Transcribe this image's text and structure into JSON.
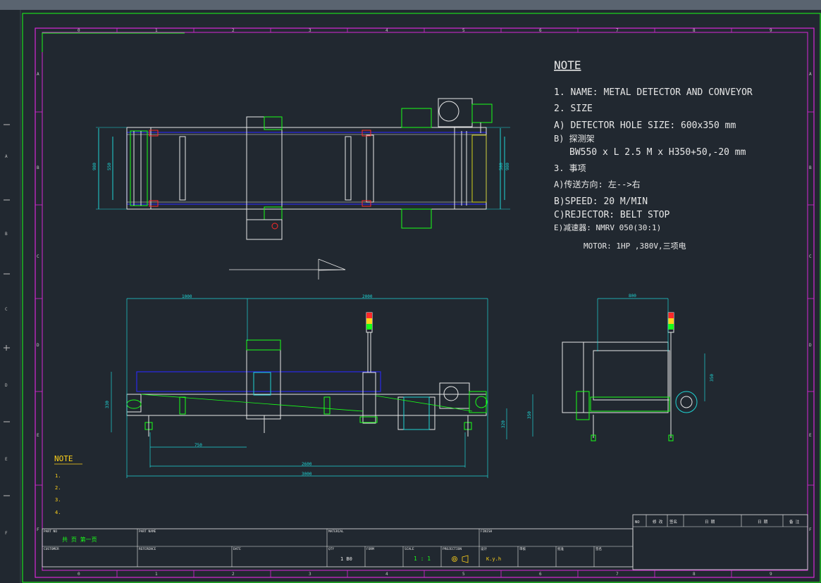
{
  "left_ruler_marks": [
    "A",
    "B",
    "C",
    "D",
    "E",
    "F"
  ],
  "border": {
    "col_numbers": [
      "0",
      "1",
      "2",
      "3",
      "4",
      "5",
      "6",
      "7",
      "8",
      "9"
    ],
    "row_letters": [
      "A",
      "B",
      "C",
      "D",
      "E",
      "F"
    ]
  },
  "note": {
    "title": "NOTE",
    "lines": [
      "1. NAME: METAL DETECTOR AND CONVEYOR",
      "2. SIZE",
      "A) DETECTOR HOLE SIZE: 600x350 mm",
      "B) 探测架",
      "BW550 x L 2.5 M x H350+50,-20 mm",
      "3. 事项",
      "A)传送方向: 左-->右",
      "B)SPEED: 20 M/MIN",
      "C)REJECTOR: BELT STOP",
      "E)减速器: NMRV 050(30:1)",
      "MOTOR: 1HP ,380V,三项电"
    ]
  },
  "small_note": {
    "title": "NOTE",
    "items": [
      "1.",
      "2.",
      "3.",
      "4."
    ]
  },
  "dims": {
    "top_left_outer": "980",
    "top_left_inner": "550",
    "top_right_inner": "580",
    "top_right_outer": "980",
    "side_1000": "1000",
    "side_2000": "2000",
    "side_330": "330",
    "side_750": "750",
    "side_2600": "2600",
    "side_3000": "3000",
    "side_320": "320",
    "side_350": "350",
    "end_800": "800",
    "end_350": "350"
  },
  "title_block": {
    "part_no_label": "PART NO",
    "part_name_label": "PART NAME",
    "material_label": "MATERIAL",
    "finish_label": "FINISH",
    "customer_label": "CUSTOMER",
    "reference_label": "REFERENCE",
    "date_label": "DATE",
    "qty_label": "QTY",
    "form_label": "FORM",
    "scale_label": "SCALE",
    "projection_label": "PROJECTION",
    "drawn_label": "设计",
    "check_label": "审核",
    "approve_label": "批准",
    "sign_label": "签名",
    "pages": "共  页    第一页",
    "qty_value": "1 B0",
    "scale_value": "1 : 1",
    "designer": "K.y.h"
  },
  "revision_table": {
    "headers": [
      "NO",
      "修 改",
      "签名",
      "日 期",
      "日 期",
      "备 注"
    ]
  },
  "colors": {
    "green": "#19ff19",
    "white": "#e8e8e8",
    "cyan": "#1fd5d5",
    "blue": "#2a2ae8",
    "red": "#ff2a2a",
    "yellow": "#ffd21a",
    "magenta": "#d728d7"
  }
}
